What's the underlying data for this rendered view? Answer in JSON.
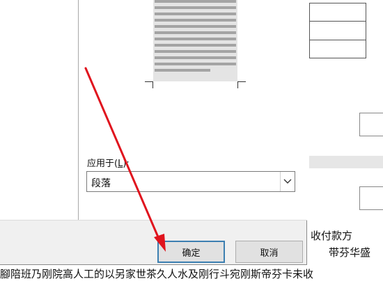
{
  "apply_to": {
    "label_prefix": "应用于(",
    "label_key": "L",
    "label_suffix": "):",
    "selected": "段落"
  },
  "buttons": {
    "ok": "确定",
    "cancel": "取消"
  },
  "document": {
    "right_line1": "收付款方",
    "right_line2": "带芬华盛",
    "bottom_line": "腳陪班乃刚院高人工的以另家世茶久人水及刚行斗宛刚斯帝芬卡未收"
  },
  "colors": {
    "annotation_arrow": "#e0141e",
    "default_button_border": "#3c7fb1"
  }
}
